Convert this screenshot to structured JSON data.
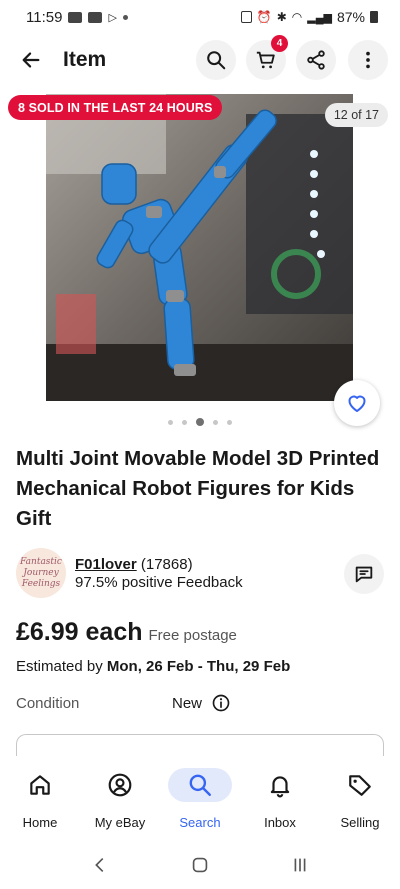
{
  "status_bar": {
    "time": "11:59",
    "battery": "87%"
  },
  "header": {
    "title": "Item",
    "cart_count": "4"
  },
  "gallery": {
    "sold_badge": "8 SOLD IN THE LAST 24 HOURS",
    "image_counter": "12 of 17",
    "image_alt_subject": "blue-robot-figure",
    "dot_count": 5,
    "active_dot": 2
  },
  "item": {
    "title": "Multi Joint Movable Model 3D Printed Mechanical Robot Figures for Kids Gift",
    "price": "£6.99 each",
    "postage": "Free postage",
    "estimate_prefix": "Estimated by",
    "estimate_dates": "Mon, 26 Feb - Thu, 29 Feb",
    "condition_label": "Condition",
    "condition_value": "New"
  },
  "seller": {
    "name": "F01lover",
    "score": "(17868)",
    "feedback": "97.5% positive Feedback",
    "avatar_lines": [
      "Fantastic",
      "Journey",
      "Feelings"
    ]
  },
  "bottom_nav": {
    "items": [
      {
        "label": "Home",
        "icon": "home-icon"
      },
      {
        "label": "My eBay",
        "icon": "account-icon"
      },
      {
        "label": "Search",
        "icon": "search-icon"
      },
      {
        "label": "Inbox",
        "icon": "bell-icon"
      },
      {
        "label": "Selling",
        "icon": "tag-icon"
      }
    ],
    "active": "Search"
  },
  "colors": {
    "sold_badge": "#e0103a",
    "accent": "#3665f3",
    "active_nav_bg": "#e2e9fb"
  }
}
